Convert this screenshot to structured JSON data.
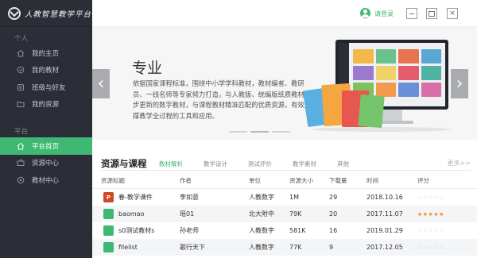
{
  "app": {
    "title": "人教智慧教学平台"
  },
  "sidebar": {
    "section_personal": "个人",
    "section_platform": "平台",
    "personal_items": [
      {
        "label": "我的主页",
        "icon": "home-icon"
      },
      {
        "label": "我的教材",
        "icon": "book-icon"
      },
      {
        "label": "班级与好友",
        "icon": "users-icon"
      },
      {
        "label": "我的资源",
        "icon": "folder-icon"
      }
    ],
    "platform_items": [
      {
        "label": "平台首页",
        "icon": "home-icon",
        "active": true
      },
      {
        "label": "资源中心",
        "icon": "resource-icon"
      },
      {
        "label": "教材中心",
        "icon": "textbook-icon"
      }
    ]
  },
  "topbar": {
    "login_label": "请登录",
    "close_glyph": "×"
  },
  "banner": {
    "title": "专业",
    "description": "依据国家课程标准，围绕中小学学科教材，教材编者、教研员、一线名师等专家倾力打造，与人教版、统编版纸质教材同步更新的数字教材，与课程教材精准匹配的优质资源，有效支撑教学全过程的工具和应用。",
    "prev_glyph": "‹",
    "next_glyph": "›",
    "slide_count": 3,
    "active_slide": 2
  },
  "resources": {
    "title": "资源与课程",
    "tabs": [
      "教材解析",
      "教学设计",
      "测试评价",
      "教学素材",
      "其他"
    ],
    "active_tab": 0,
    "more_label": "更多>>",
    "columns": [
      "资源标题",
      "作者",
      "单位",
      "资源大小",
      "下载量",
      "时间",
      "评分"
    ],
    "rows": [
      {
        "title": "春-教学课件",
        "type": "ppt",
        "type_glyph": "P",
        "author": "李如意",
        "unit": "人教数字",
        "size": "1M",
        "downloads": "29",
        "time": "2018.10.16",
        "rating": 0
      },
      {
        "title": "baomao",
        "type": "folder",
        "type_glyph": "",
        "author": "瑶01",
        "unit": "北大附中",
        "size": "79K",
        "downloads": "20",
        "time": "2017.11.07",
        "rating": 5
      },
      {
        "title": "s0测试教材s",
        "type": "folder",
        "type_glyph": "",
        "author": "孙老师",
        "unit": "人教数字",
        "size": "581K",
        "downloads": "16",
        "time": "2019.01.29",
        "rating": 0
      },
      {
        "title": "filelist",
        "type": "folder",
        "type_glyph": "",
        "author": "歌行天下",
        "unit": "人教数字",
        "size": "77K",
        "downloads": "9",
        "time": "2017.12.05",
        "rating": 0
      }
    ]
  },
  "colors": {
    "accent": "#3fb873",
    "sidebar_bg": "#2b2e36",
    "star": "#f08a24",
    "ppt": "#d24726"
  }
}
